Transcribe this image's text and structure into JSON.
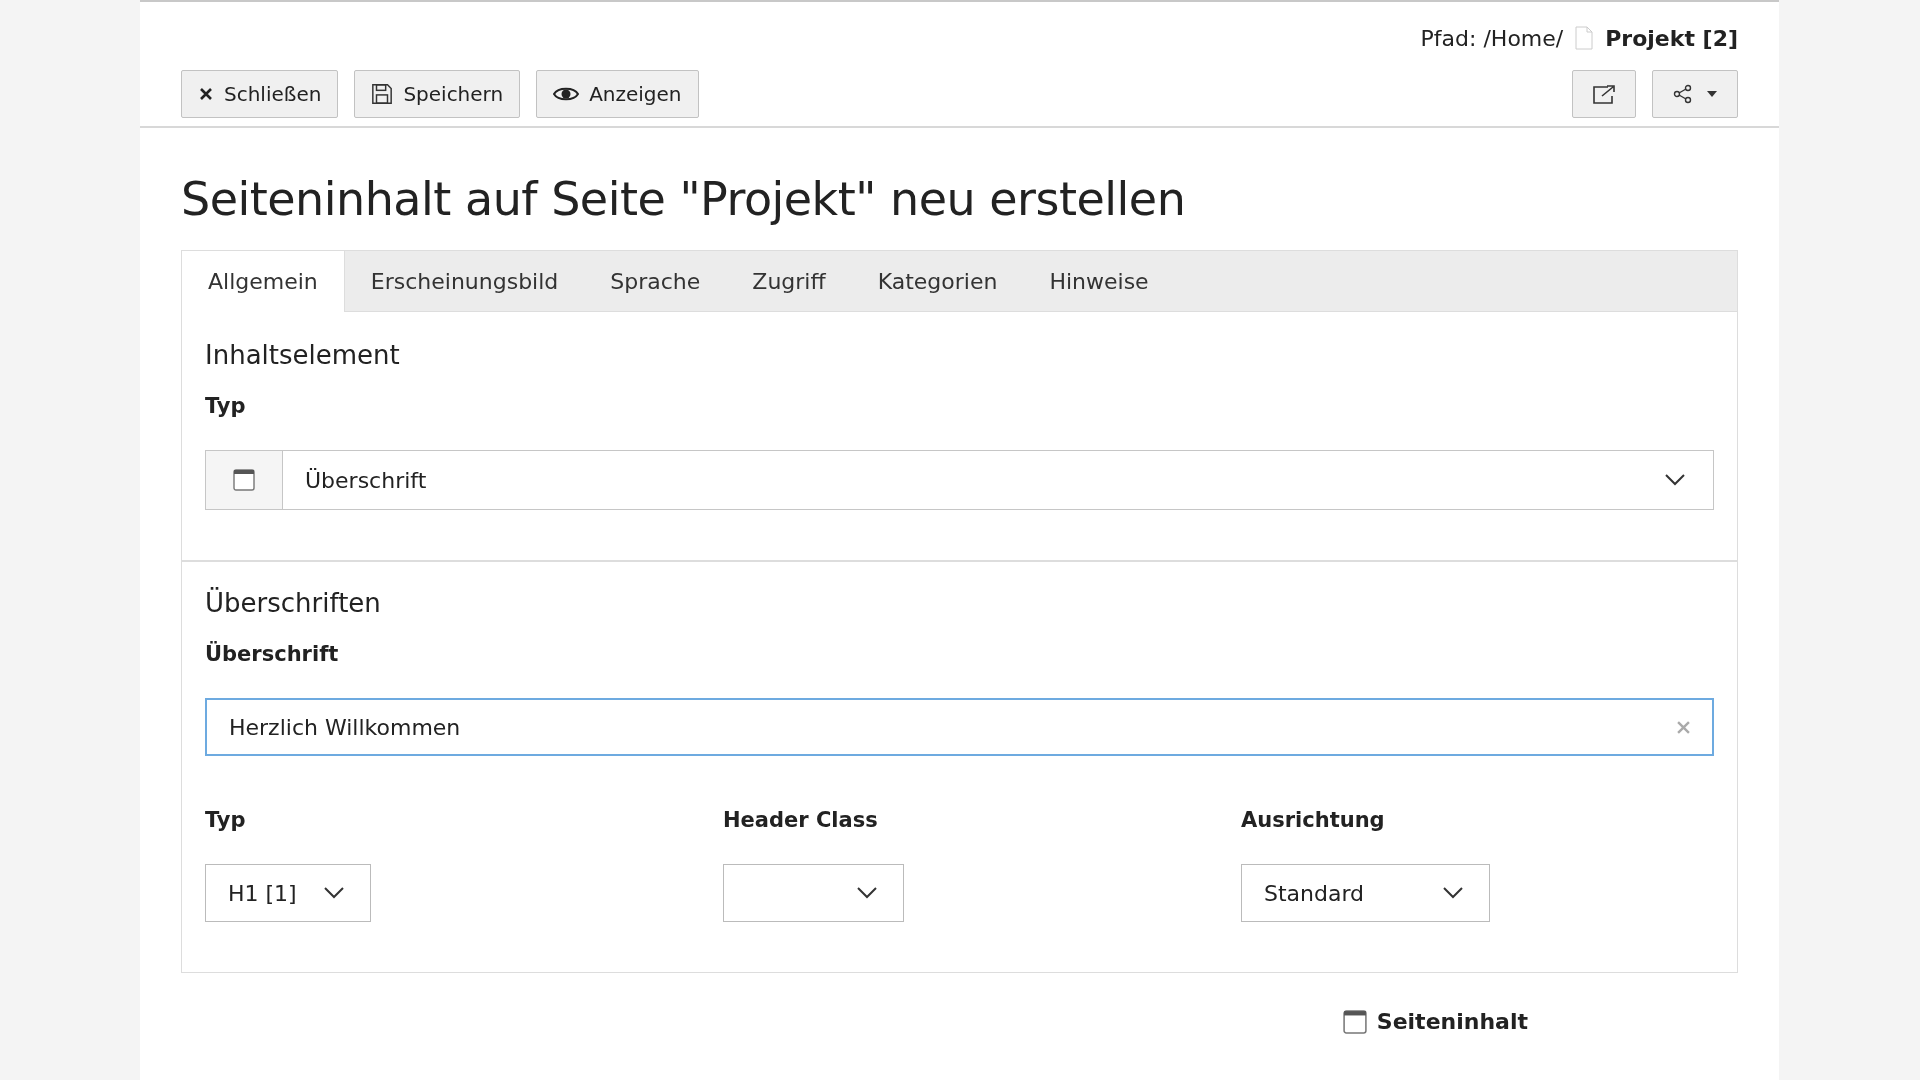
{
  "path": {
    "label": "Pfad: /Home/",
    "page": "Projekt [2]"
  },
  "toolbar": [
    {
      "kind": "close",
      "label": "Schließen"
    },
    {
      "kind": "save",
      "label": "Speichern"
    },
    {
      "kind": "view",
      "label": "Anzeigen"
    }
  ],
  "title": "Seiteninhalt auf Seite \"Projekt\" neu erstellen",
  "tabs": [
    {
      "label": "Allgemein",
      "selected": true
    },
    {
      "label": "Erscheinungsbild",
      "selected": false
    },
    {
      "label": "Sprache",
      "selected": false
    },
    {
      "label": "Zugriff",
      "selected": false
    },
    {
      "label": "Kategorien",
      "selected": false
    },
    {
      "label": "Hinweise",
      "selected": false
    }
  ],
  "content_element": {
    "heading": "Inhaltselement",
    "type_label": "Typ",
    "type_value": "Überschrift"
  },
  "headers": {
    "heading": "Überschriften",
    "header_label": "Überschrift",
    "header_value": "Herzlich Willkommen",
    "selects": [
      {
        "label": "Typ",
        "value": "H1 [1]"
      },
      {
        "label": "Header Class"
      },
      {
        "label": "Ausrichtung",
        "value": "Standard"
      }
    ]
  },
  "footer": {
    "label": "Seiteninhalt"
  }
}
